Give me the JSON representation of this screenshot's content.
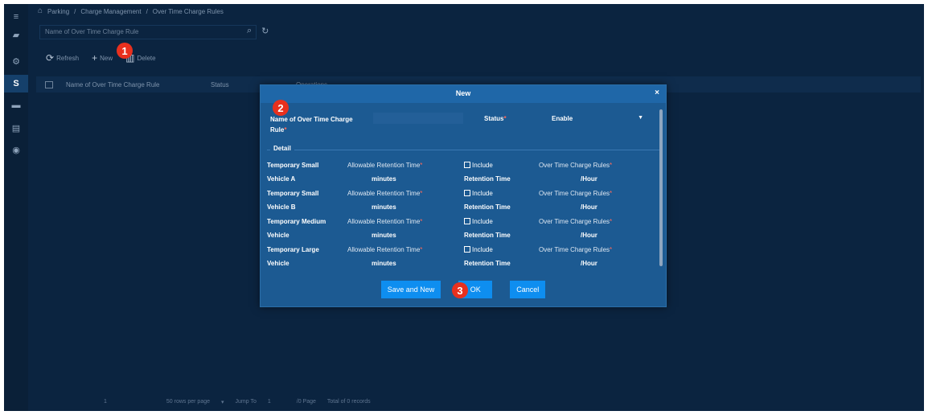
{
  "breadcrumb": [
    "Parking",
    "/",
    "Charge Management",
    "/",
    "Over Time Charge Rules"
  ],
  "search": {
    "placeholder": "Name of Over Time Charge Rule"
  },
  "toolbar": {
    "refresh": "Refresh",
    "new": "New",
    "delete": "Delete"
  },
  "table": {
    "headers": [
      "Name of Over Time Charge Rule",
      "Status",
      "Operations"
    ]
  },
  "pagination": {
    "page": "1",
    "rows_per_page": "50 rows per page",
    "jump_to": "Jump To",
    "jump_value": "1",
    "pages": "/0 Page",
    "total": "Total of 0 records"
  },
  "markers": [
    "1",
    "2",
    "3"
  ],
  "sidebar": {
    "active_letter": "S"
  },
  "modal": {
    "title": "New",
    "close": "×",
    "name_label": "Name of Over Time Charge Rule",
    "status_label": "Status",
    "status_value": "Enable",
    "detail_title": "Detail",
    "rows": [
      {
        "vehicle": "Temporary Small Vehicle A",
        "retention_label": "Allowable Retention Time",
        "minutes": "minutes",
        "include": "Include",
        "retention_time": "Retention Time",
        "charge_label": "Over Time Charge Rules",
        "hour": "/Hour"
      },
      {
        "vehicle": "Temporary Small Vehicle B",
        "retention_label": "Allowable Retention Time",
        "minutes": "minutes",
        "include": "Include",
        "retention_time": "Retention Time",
        "charge_label": "Over Time Charge Rules",
        "hour": "/Hour"
      },
      {
        "vehicle": "Temporary Medium Vehicle",
        "retention_label": "Allowable Retention Time",
        "minutes": "minutes",
        "include": "Include",
        "retention_time": "Retention Time",
        "charge_label": "Over Time Charge Rules",
        "hour": "/Hour"
      },
      {
        "vehicle": "Temporary Large Vehicle",
        "retention_label": "Allowable Retention Time",
        "minutes": "minutes",
        "include": "Include",
        "retention_time": "Retention Time",
        "charge_label": "Over Time Charge Rules",
        "hour": "/Hour"
      }
    ],
    "buttons": {
      "save_new": "Save and New",
      "ok": "OK",
      "cancel": "Cancel"
    }
  },
  "colors": {
    "background": "#0b2440",
    "modal": "#1c5a92",
    "button": "#0e8ef0",
    "marker": "#e8301e"
  }
}
